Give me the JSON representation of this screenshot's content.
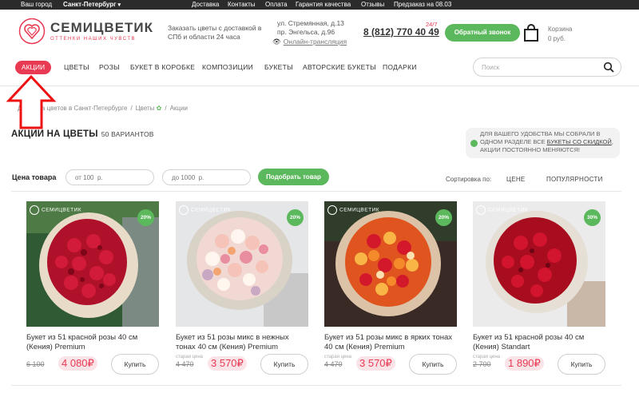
{
  "topbar": {
    "region_label": "Ваш город",
    "city": "Санкт-Петербург",
    "links": [
      "Доставка",
      "Контакты",
      "Оплата",
      "Гарантия качества",
      "Отзывы"
    ],
    "preorder": "Предзаказ на 08.03"
  },
  "brand": {
    "name": "СЕМИЦВЕТИК",
    "tagline": "оттенки наших чувств",
    "accent_color": "#e83a53",
    "green_color": "#5cb85c"
  },
  "header": {
    "order_text": "Заказать цветы с доставкой в СПб и области 24 часа",
    "address_line1": "ул. Стремянная, д.13",
    "address_line2": "пр. Энгельса, д.96",
    "live_link": "Онлайн-трансляция",
    "badge_247": "24/7",
    "phone": "8 (812) 770 40 49",
    "callback_button": "Обратный звонок",
    "cart_title": "Корзина",
    "cart_sum": "0 руб."
  },
  "nav": {
    "active": "АКЦИИ",
    "items": [
      "ЦВЕТЫ",
      "РОЗЫ",
      "БУКЕТ В КОРОБКЕ",
      "КОМПОЗИЦИИ",
      "БУКЕТЫ",
      "АВТОРСКИЕ БУКЕТЫ",
      "ПОДАРКИ"
    ]
  },
  "search": {
    "placeholder": "Поиск"
  },
  "breadcrumb": [
    "Доставка цветов в Санкт-Петербурге",
    "Цветы",
    "Акции"
  ],
  "page": {
    "title": "АКЦИИ НА ЦВЕТЫ",
    "variants": "50 ВАРИАНТОВ"
  },
  "info_box": {
    "text_before": "ДЛЯ ВАШЕГО УДОБСТВА МЫ СОБРАЛИ В ОДНОМ РАЗДЕЛЕ ВСЕ ",
    "link": "БУКЕТЫ СО СКИДКОЙ",
    "text_after": ", АКЦИИ ПОСТОЯННО МЕНЯЮТСЯ!"
  },
  "filter": {
    "label": "Цена товара",
    "from_placeholder": "от 100  р.",
    "to_placeholder": "до 1000  р.",
    "button": "Подобрать товар",
    "sort_label": "Сортировка по:",
    "sort_options": [
      "ЦЕНЕ",
      "ПОПУЛЯРНОСТИ"
    ]
  },
  "products": [
    {
      "name": "Букет из 51 красной розы 40 см (Кения) Premium",
      "old_label": "",
      "old_price": "6 100",
      "new_price": "4 080₽",
      "discount": "20%",
      "buy": "Купить",
      "logo": "СЕМИЦВЕТИК"
    },
    {
      "name": "Букет из 51 розы микс в нежных тонах 40 см (Кения) Premium",
      "old_label": "старая цена",
      "old_price": "4 470",
      "new_price": "3 570₽",
      "discount": "20%",
      "buy": "Купить",
      "logo": "СЕМИЦВЕТИК"
    },
    {
      "name": "Букет из 51 розы микс в ярких тонах 40 см (Кения) Premium",
      "old_label": "старая цена",
      "old_price": "4 470",
      "new_price": "3 570₽",
      "discount": "20%",
      "buy": "Купить",
      "logo": "СЕМИЦВЕТИК"
    },
    {
      "name": "Букет из 51 красной розы 40 см (Кения) Standart",
      "old_label": "старая цена",
      "old_price": "2 700",
      "new_price": "1 890₽",
      "discount": "30%",
      "buy": "Купить",
      "logo": "СЕМИЦВЕТИК"
    }
  ]
}
